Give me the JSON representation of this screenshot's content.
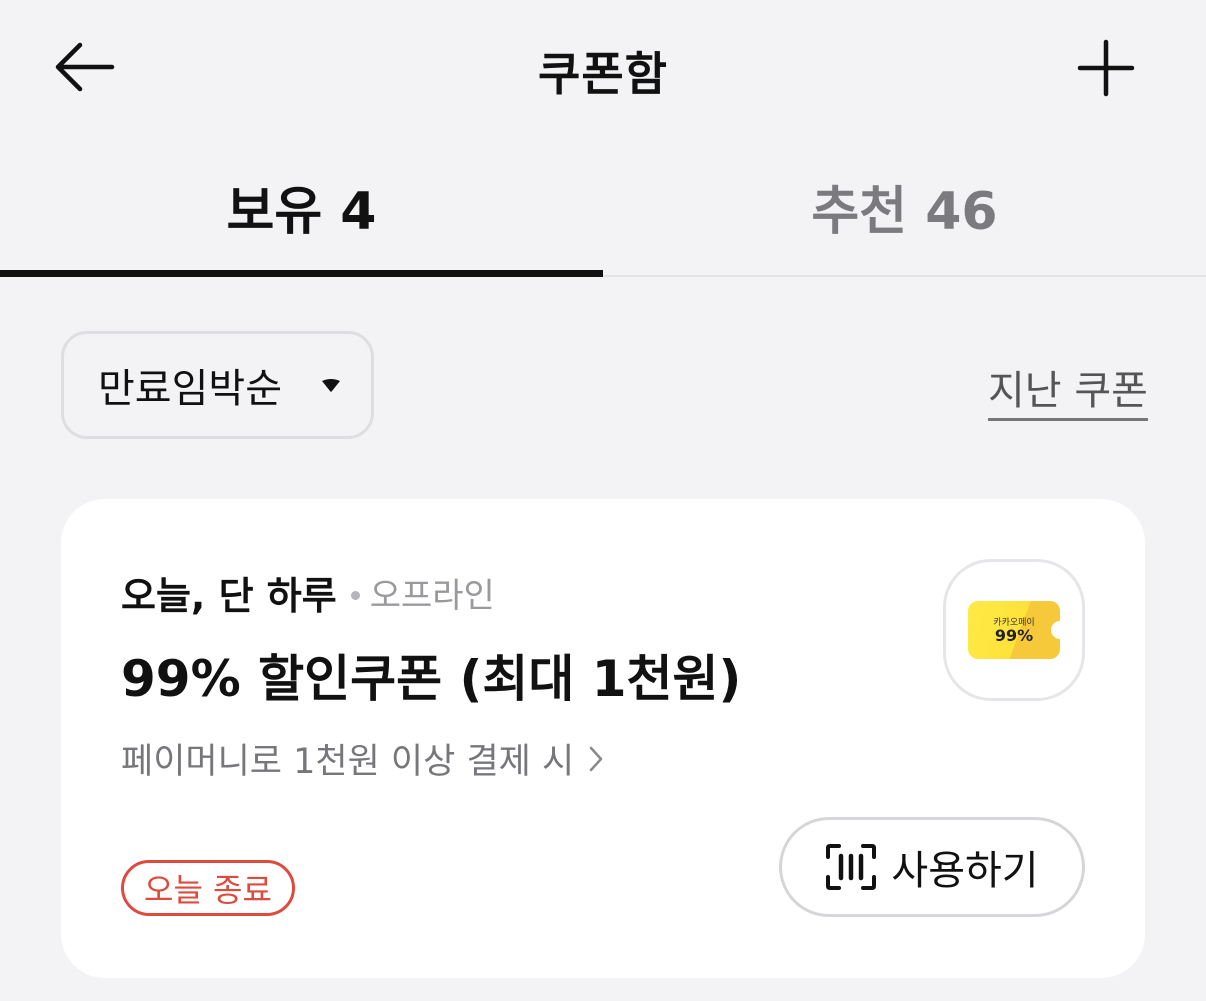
{
  "header": {
    "title": "쿠폰함",
    "back_icon": "arrow-left-icon",
    "add_icon": "plus-icon"
  },
  "tabs": [
    {
      "label": "보유 4",
      "active": true
    },
    {
      "label": "추천 46",
      "active": false
    }
  ],
  "filter": {
    "sort_label": "만료임박순",
    "sort_icon": "caret-down-icon",
    "past_link": "지난 쿠폰"
  },
  "coupon": {
    "meta_main": "오늘, 단 하루",
    "meta_sub": "오프라인",
    "title": "99% 할인쿠폰 (최대 1천원)",
    "condition": "페이머니로 1천원 이상 결제 시",
    "thumb_brand": "카카오페이",
    "thumb_rate": "99%",
    "badge": "오늘 종료",
    "use_label": "사용하기",
    "use_icon": "barcode-scan-icon"
  },
  "colors": {
    "background": "#f3f3f5",
    "card": "#ffffff",
    "badge_red": "#dc4b3e",
    "ticket_yellow": "#ffe23a"
  }
}
